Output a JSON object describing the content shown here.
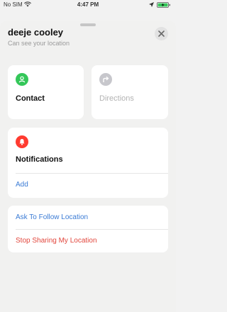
{
  "status_bar": {
    "carrier": "No SIM",
    "time": "4:47 PM"
  },
  "header": {
    "name": "deeje cooley",
    "subtitle": "Can see your location"
  },
  "actions": {
    "contact_label": "Contact",
    "directions_label": "Directions"
  },
  "notifications": {
    "title": "Notifications",
    "add_label": "Add"
  },
  "sharing": {
    "follow_label": "Ask To Follow Location",
    "stop_label": "Stop Sharing My Location"
  },
  "colors": {
    "accent_blue": "#3a7bd5",
    "destructive_red": "#e2463c",
    "contact_green": "#34c759",
    "notification_red": "#ff3b30",
    "disabled_gray": "#c7c7cc"
  },
  "icons": {
    "contact": "person-icon",
    "directions": "turn-right-arrow-icon",
    "notifications": "bell-icon",
    "close": "close-icon"
  }
}
